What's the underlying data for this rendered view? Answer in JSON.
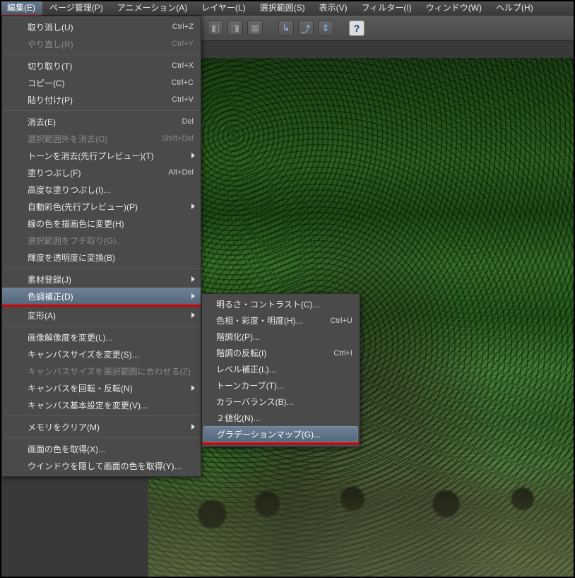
{
  "menubar": {
    "items": [
      {
        "label": "編集(E)",
        "active": true
      },
      {
        "label": "ページ管理(P)"
      },
      {
        "label": "アニメーション(A)"
      },
      {
        "label": "レイヤー(L)"
      },
      {
        "label": "選択範囲(S)"
      },
      {
        "label": "表示(V)"
      },
      {
        "label": "フィルター(I)"
      },
      {
        "label": "ウィンドウ(W)"
      },
      {
        "label": "ヘルプ(H)"
      }
    ]
  },
  "edit_menu": [
    {
      "type": "item",
      "label": "取り消し(U)",
      "shortcut": "Ctrl+Z"
    },
    {
      "type": "item",
      "label": "やり直し(R)",
      "shortcut": "Ctrl+Y",
      "disabled": true
    },
    {
      "type": "sep"
    },
    {
      "type": "item",
      "label": "切り取り(T)",
      "shortcut": "Ctrl+X"
    },
    {
      "type": "item",
      "label": "コピー(C)",
      "shortcut": "Ctrl+C"
    },
    {
      "type": "item",
      "label": "貼り付け(P)",
      "shortcut": "Ctrl+V"
    },
    {
      "type": "sep"
    },
    {
      "type": "item",
      "label": "消去(E)",
      "shortcut": "Del"
    },
    {
      "type": "item",
      "label": "選択範囲外を消去(O)",
      "shortcut": "Shift+Del",
      "disabled": true
    },
    {
      "type": "item",
      "label": "トーンを消去(先行プレビュー)(T)",
      "submenu": true
    },
    {
      "type": "item",
      "label": "塗りつぶし(F)",
      "shortcut": "Alt+Del"
    },
    {
      "type": "item",
      "label": "高度な塗りつぶし(I)..."
    },
    {
      "type": "item",
      "label": "自動彩色(先行プレビュー)(P)",
      "submenu": true
    },
    {
      "type": "item",
      "label": "線の色を描画色に変更(H)"
    },
    {
      "type": "item",
      "label": "選択範囲をフチ取り(G)...",
      "disabled": true
    },
    {
      "type": "item",
      "label": "輝度を透明度に変換(B)"
    },
    {
      "type": "sep"
    },
    {
      "type": "item",
      "label": "素材登録(J)",
      "submenu": true
    },
    {
      "type": "item",
      "label": "色調補正(D)",
      "submenu": true,
      "highlight": true
    },
    {
      "type": "red"
    },
    {
      "type": "item",
      "label": "変形(A)",
      "submenu": true
    },
    {
      "type": "sep"
    },
    {
      "type": "item",
      "label": "画像解像度を変更(L)..."
    },
    {
      "type": "item",
      "label": "キャンバスサイズを変更(S)..."
    },
    {
      "type": "item",
      "label": "キャンバスサイズを選択範囲に合わせる(Z)",
      "disabled": true
    },
    {
      "type": "item",
      "label": "キャンバスを回転・反転(N)",
      "submenu": true
    },
    {
      "type": "item",
      "label": "キャンバス基本設定を変更(V)..."
    },
    {
      "type": "sep"
    },
    {
      "type": "item",
      "label": "メモリをクリア(M)",
      "submenu": true
    },
    {
      "type": "sep"
    },
    {
      "type": "item",
      "label": "画面の色を取得(X)..."
    },
    {
      "type": "item",
      "label": "ウインドウを隠して画面の色を取得(Y)..."
    }
  ],
  "submenu": [
    {
      "type": "item",
      "label": "明るさ・コントラスト(C)..."
    },
    {
      "type": "item",
      "label": "色相・彩度・明度(H)...",
      "shortcut": "Ctrl+U"
    },
    {
      "type": "item",
      "label": "階調化(P)..."
    },
    {
      "type": "item",
      "label": "階調の反転(I)",
      "shortcut": "Ctrl+I"
    },
    {
      "type": "item",
      "label": "レベル補正(L)..."
    },
    {
      "type": "item",
      "label": "トーンカーブ(T)..."
    },
    {
      "type": "item",
      "label": "カラーバランス(B)..."
    },
    {
      "type": "item",
      "label": "２値化(N)..."
    },
    {
      "type": "item",
      "label": "グラデーションマップ(G)...",
      "highlight": true
    },
    {
      "type": "red"
    }
  ],
  "toolbar": {
    "help": "?"
  }
}
